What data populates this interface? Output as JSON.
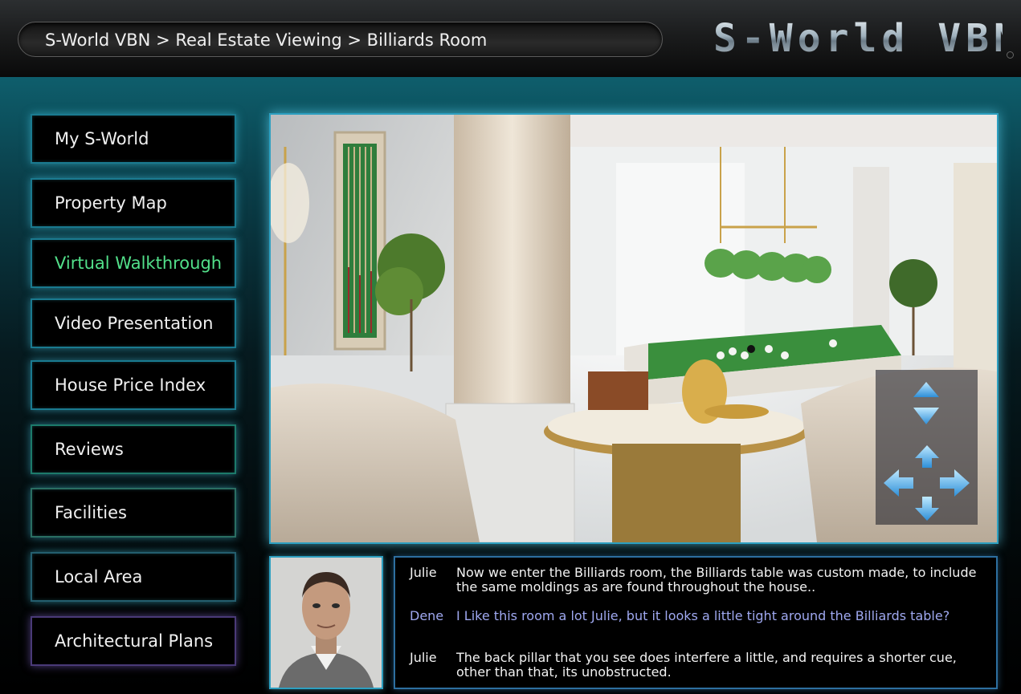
{
  "header": {
    "breadcrumb": "S-World VBN > Real Estate Viewing > Billiards Room",
    "logo": "S-World VBN"
  },
  "sidebar": {
    "items": [
      {
        "label": "My S-World",
        "active": false
      },
      {
        "label": "Property Map",
        "active": false
      },
      {
        "label": "Virtual Walkthrough",
        "active": true
      },
      {
        "label": "Video Presentation",
        "active": false
      },
      {
        "label": "House Price Index",
        "active": false
      },
      {
        "label": "Reviews",
        "active": false
      },
      {
        "label": "Facilities",
        "active": false
      },
      {
        "label": "Local Area",
        "active": false
      },
      {
        "label": "Architectural Plans",
        "active": false
      }
    ]
  },
  "viewer": {
    "scene": "billiards-room-panorama",
    "controls": [
      "arrow-up-icon",
      "arrow-down-icon",
      "move-up-icon",
      "move-left-icon",
      "move-right-icon",
      "move-down-icon"
    ]
  },
  "chat": {
    "messages": [
      {
        "speaker": "Julie",
        "text": "Now we enter the Billiards room, the Billiards table was custom made, to include the same moldings as are found throughout the house.."
      },
      {
        "speaker": "Dene",
        "text": "I Like this room a lot Julie, but it looks a little tight around the Billiards table?"
      },
      {
        "speaker": "Julie",
        "text": "The back pillar that you see does interfere a little, and requires a shorter cue, other than that, its unobstructed."
      }
    ]
  },
  "colors": {
    "accent_glow": "#46c8e6",
    "active_nav": "#52e08a",
    "dene_text": "#9fa8f0"
  }
}
